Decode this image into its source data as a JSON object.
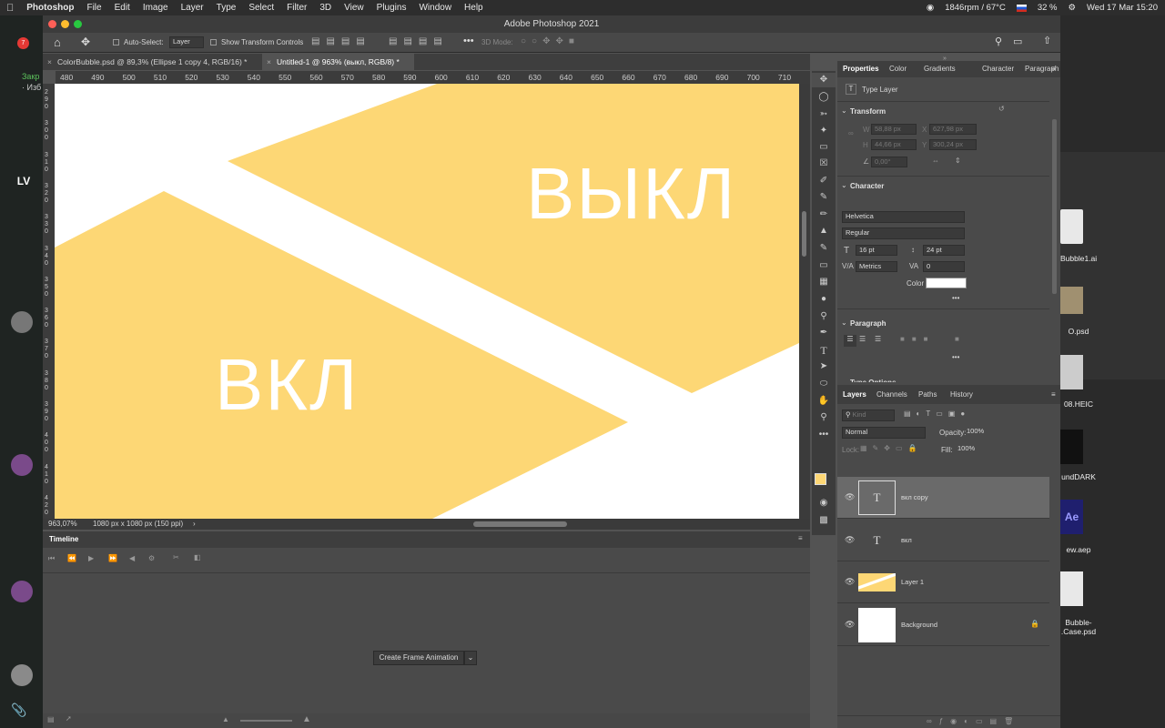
{
  "menubar": {
    "app": "Photoshop",
    "items": [
      "File",
      "Edit",
      "Image",
      "Layer",
      "Type",
      "Select",
      "Filter",
      "3D",
      "View",
      "Plugins",
      "Window",
      "Help"
    ],
    "status_temp": "1846rpm / 67°C",
    "battery": "32 %",
    "datetime": "Wed 17 Mar  15:20"
  },
  "window": {
    "title": "Adobe Photoshop 2021"
  },
  "options": {
    "auto_select_label": "Auto-Select:",
    "auto_select_value": "Layer",
    "transform_label": "Show Transform Controls",
    "mode_3d": "3D Mode:"
  },
  "doc_tabs": [
    {
      "label": "ColorBubble.psd @ 89,3% (Ellipse 1 copy 4, RGB/16) *"
    },
    {
      "label": "Untitled-1 @ 963% (выкл, RGB/8) *"
    }
  ],
  "ruler": {
    "top_ticks": [
      "480",
      "490",
      "500",
      "510",
      "520",
      "530",
      "540",
      "550",
      "560",
      "570",
      "580",
      "590",
      "600",
      "610",
      "620",
      "630",
      "640",
      "650",
      "660",
      "670",
      "680",
      "690",
      "700",
      "710"
    ],
    "left_ticks": [
      "290",
      "300",
      "310",
      "320",
      "330",
      "340",
      "350",
      "360",
      "370",
      "380",
      "390",
      "400",
      "410",
      "420"
    ]
  },
  "canvas": {
    "text_off": "ВЫКЛ",
    "text_on": "ВКЛ",
    "fill_color": "#fdd775",
    "bg_color": "#ffffff"
  },
  "status": {
    "zoom": "963,07%",
    "doc_size": "1080 px x 1080 px (150 ppi)"
  },
  "timeline": {
    "title": "Timeline",
    "create_button": "Create Frame Animation"
  },
  "properties": {
    "tabs": [
      "Properties",
      "Color",
      "Gradients",
      "Character",
      "Paragraph"
    ],
    "type_label": "Type Layer",
    "transform_title": "Transform",
    "w_label": "W",
    "w_value": "58,88 px",
    "x_label": "X",
    "x_value": "627,98 px",
    "h_label": "H",
    "h_value": "44,66 px",
    "y_label": "Y",
    "y_value": "300,24 px",
    "angle_value": "0,00°",
    "character_title": "Character",
    "font_family": "Helvetica",
    "font_style": "Regular",
    "font_size": "16 pt",
    "leading": "24 pt",
    "kerning": "Metrics",
    "tracking": "0",
    "color_label": "Color",
    "paragraph_title": "Paragraph",
    "type_options": "Type Options"
  },
  "layers_panel": {
    "tabs": [
      "Layers",
      "Channels",
      "Paths",
      "History"
    ],
    "filter_kind": "Kind",
    "blend_mode": "Normal",
    "opacity_label": "Opacity:",
    "opacity_value": "100%",
    "lock_label": "Lock:",
    "fill_label": "Fill:",
    "fill_value": "100%",
    "layers": [
      {
        "name": "вкл copy",
        "selected": true
      },
      {
        "name": "вкл",
        "selected": false
      },
      {
        "name": "Layer 1",
        "selected": false
      },
      {
        "name": "Background",
        "selected": false
      }
    ]
  },
  "desktop_files": [
    {
      "label": "Bubble1.ai"
    },
    {
      "label": "O.psd"
    },
    {
      "label": "08.HEIC"
    },
    {
      "label": "undDARK"
    },
    {
      "label": "ew.aep"
    },
    {
      "label": "Bubble-\n.Case.psd"
    }
  ],
  "left_sidebar": {
    "badge": "7",
    "text1": "Закр",
    "text2": "· Изб"
  }
}
